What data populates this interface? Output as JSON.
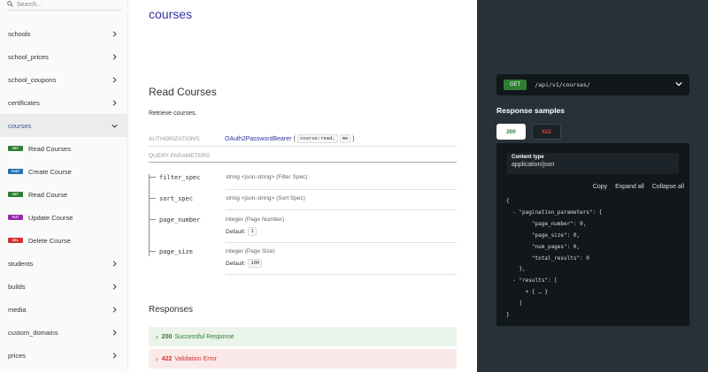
{
  "search": {
    "placeholder": "Search..."
  },
  "sidebar": {
    "items": [
      {
        "label": "schools"
      },
      {
        "label": "school_prices"
      },
      {
        "label": "school_coupons"
      },
      {
        "label": "certificates"
      },
      {
        "label": "courses"
      },
      {
        "label": "students"
      },
      {
        "label": "builds"
      },
      {
        "label": "media"
      },
      {
        "label": "custom_domains"
      },
      {
        "label": "prices"
      }
    ],
    "sub_items": [
      {
        "method": "GET",
        "label": "Read Courses"
      },
      {
        "method": "POST",
        "label": "Create Course"
      },
      {
        "method": "GET",
        "label": "Read Course"
      },
      {
        "method": "PUT",
        "label": "Update Course"
      },
      {
        "method": "DEL",
        "label": "Delete Course"
      }
    ]
  },
  "main": {
    "section_title": "courses",
    "op_title": "Read Courses",
    "op_description": "Retrieve courses.",
    "auth": {
      "label": "AUTHORIZATIONS:",
      "scheme": "OAuth2PasswordBearer",
      "open_paren": "(",
      "scopes": [
        "course:read,",
        "me"
      ],
      "close_paren": ")"
    },
    "query_label": "QUERY PARAMETERS",
    "params": [
      {
        "name": "filter_spec",
        "info": "string <json-string> (Filter Spec)"
      },
      {
        "name": "sort_spec",
        "info": "string <json-string> (Sort Spec)"
      },
      {
        "name": "page_number",
        "info": "integer (Page Number)",
        "default_label": "Default:",
        "default_value": "1"
      },
      {
        "name": "page_size",
        "info": "integer (Page Size)",
        "default_label": "Default:",
        "default_value": "100"
      }
    ],
    "responses_title": "Responses",
    "responses": [
      {
        "code": "200",
        "text": "Successful Response"
      },
      {
        "code": "422",
        "text": "Validation Error"
      }
    ]
  },
  "right": {
    "method": "GET",
    "path": "/api/v1/courses/",
    "samples_title": "Response samples",
    "tabs": [
      "200",
      "422"
    ],
    "content_type_label": "Content type",
    "content_type_value": "application/json",
    "actions": [
      "Copy",
      "Expand all",
      "Collapse all"
    ],
    "json_lines": [
      "{",
      "  - \"pagination_parameters\": {",
      "        \"page_number\": 0,",
      "        \"page_size\": 0,",
      "        \"num_pages\": 0,",
      "        \"total_results\": 0",
      "    },",
      "  - \"results\": [",
      "      + { … }",
      "    ]",
      "}"
    ]
  },
  "colors": {
    "accent": "#32329f",
    "get": "#2e7d32",
    "post": "#1f6fb2",
    "put": "#9c27b0",
    "delete": "#d32f2f",
    "panel": "#263238"
  }
}
